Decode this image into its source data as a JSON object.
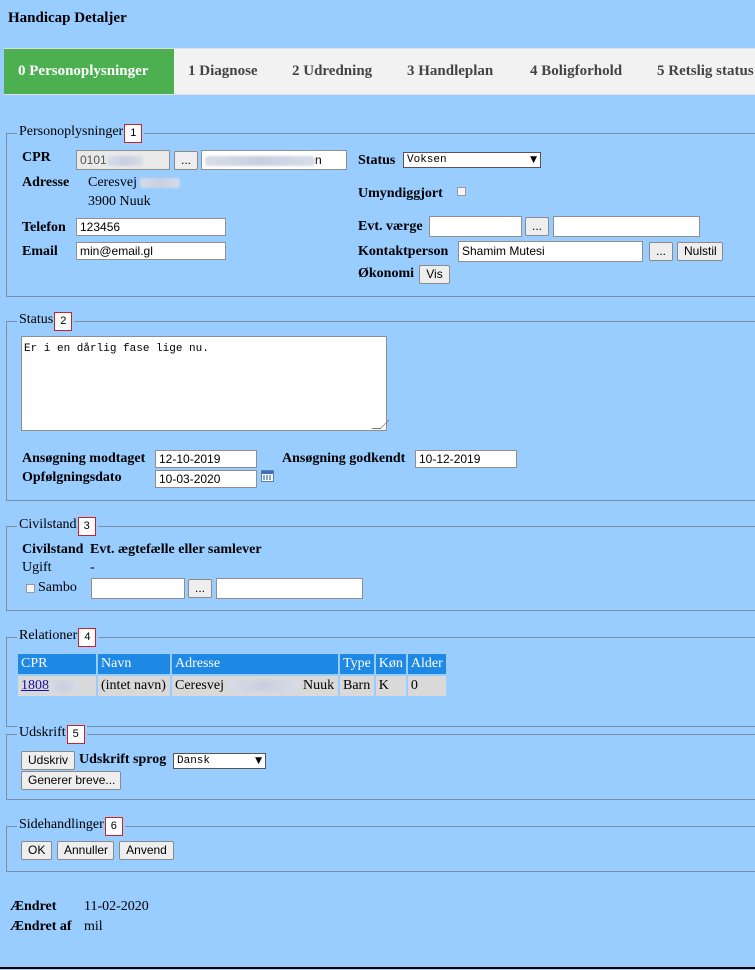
{
  "page": {
    "title": "Handicap Detaljer"
  },
  "tabs": [
    {
      "label": "0 Personoplysninger",
      "active": true
    },
    {
      "label": "1 Diagnose"
    },
    {
      "label": "2 Udredning"
    },
    {
      "label": "3 Handleplan"
    },
    {
      "label": "4 Boligforhold"
    },
    {
      "label": "5 Retslig status"
    }
  ],
  "personal": {
    "legend": "Personoplysninger",
    "number": "1",
    "cpr_label": "CPR",
    "cpr_value": "0101",
    "name_value": "n",
    "adresse_label": "Adresse",
    "adresse_line1": "Ceresvej",
    "adresse_line2": "3900 Nuuk",
    "telefon_label": "Telefon",
    "telefon_value": "123456",
    "email_label": "Email",
    "email_value": "min@email.gl",
    "status_label": "Status",
    "status_value": "Voksen",
    "umyndiggjort_label": "Umyndiggjort",
    "vaerge_label": "Evt. værge",
    "kontaktperson_label": "Kontaktperson",
    "kontaktperson_value": "Shamim Mutesi",
    "okonomi_label": "Økonomi",
    "lookup_label": "...",
    "nulstil_label": "Nulstil",
    "vis_label": "Vis"
  },
  "status": {
    "legend": "Status",
    "number": "2",
    "note": "Er i en dårlig fase lige nu.",
    "modtaget_label": "Ansøgning modtaget",
    "modtaget_value": "12-10-2019",
    "godkendt_label": "Ansøgning godkendt",
    "godkendt_value": "10-12-2019",
    "opfolgning_label": "Opfølgningsdato",
    "opfolgning_value": "10-03-2020"
  },
  "civil": {
    "legend": "Civilstand",
    "number": "3",
    "civilstand_header": "Civilstand",
    "partner_header": "Evt. ægtefælle eller samlever",
    "civilstand_value": "Ugift",
    "partner_value": "-",
    "sambo_label": "Sambo",
    "lookup_label": "..."
  },
  "relations": {
    "legend": "Relationer",
    "number": "4",
    "columns": [
      "CPR",
      "Navn",
      "Adresse",
      "Type",
      "Køn",
      "Alder"
    ],
    "rows": [
      {
        "cpr": "1808",
        "navn": "(intet navn)",
        "adresse_start": "Ceresvej",
        "adresse_end": "Nuuk",
        "type": "Barn",
        "kon": "K",
        "alder": "0"
      }
    ]
  },
  "print": {
    "legend": "Udskrift",
    "number": "5",
    "udskriv_label": "Udskriv",
    "sprog_label": "Udskrift sprog",
    "sprog_value": "Dansk",
    "generer_label": "Generer breve..."
  },
  "actions": {
    "legend": "Sidehandlinger",
    "number": "6",
    "ok_label": "OK",
    "annuller_label": "Annuller",
    "anvend_label": "Anvend"
  },
  "footer": {
    "aendret_label": "Ændret",
    "aendret_value": "11-02-2020",
    "aendret_af_label": "Ændret af",
    "aendret_af_value": "mil"
  },
  "colors": {
    "background": "#99ccff",
    "tab_active": "#4caf50",
    "table_header": "#1e88e5"
  }
}
